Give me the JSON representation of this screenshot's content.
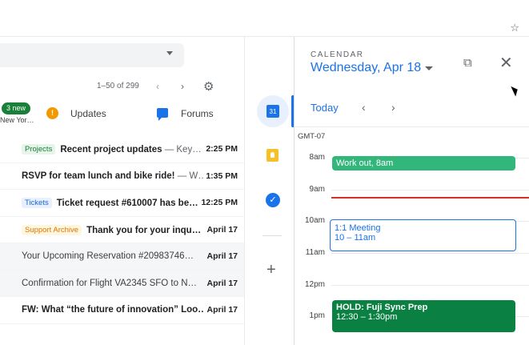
{
  "browser": {
    "star_icon": "star-icon"
  },
  "mail": {
    "pager": "1–50 of 299",
    "tabs": {
      "badge": "3 new",
      "first_sub": "New Yor…",
      "updates_label": "Updates",
      "forums_label": "Forums"
    },
    "rows": [
      {
        "label": "Projects",
        "subject": "Recent project updates",
        "snippet": " — Key…",
        "date": "2:25 PM",
        "read": false
      },
      {
        "label": "",
        "subject": "RSVP for team lunch and bike ride!",
        "snippet": " — W…",
        "date": "1:35 PM",
        "read": false
      },
      {
        "label": "Tickets",
        "subject": "Ticket request #610007 has be…",
        "snippet": "",
        "date": "12:25 PM",
        "read": false
      },
      {
        "label": "Support Archive",
        "subject": "Thank you for your inqu…",
        "snippet": "",
        "date": "April 17",
        "read": false
      },
      {
        "label": "",
        "subject": "Your Upcoming Reservation #20983746…",
        "snippet": "",
        "date": "April 17",
        "read": true
      },
      {
        "label": "",
        "subject": "Confirmation for Flight VA2345 SFO to N…",
        "snippet": "",
        "date": "April 17",
        "read": true
      },
      {
        "label": "",
        "subject": "FW: What “the future of innovation” Loo…",
        "snippet": "",
        "date": "April 17",
        "read": false
      }
    ]
  },
  "sidebar": {
    "calendar_day": "31"
  },
  "calendar": {
    "caption": "CALENDAR",
    "date": "Wednesday, Apr 18",
    "today": "Today",
    "timezone": "GMT-07",
    "hours": [
      "8am",
      "9am",
      "10am",
      "11am",
      "12pm",
      "1pm"
    ],
    "events": {
      "workout": "Work out, 8am",
      "meeting_title": "1:1 Meeting",
      "meeting_time": "10 – 11am",
      "hold_title": "HOLD: Fuji Sync Prep",
      "hold_time": "12:30 – 1:30pm"
    }
  },
  "colors": {
    "accent": "#1a73e8",
    "event_green": "#33b679",
    "event_dark_green": "#0b8043",
    "now_line": "#d93025"
  }
}
